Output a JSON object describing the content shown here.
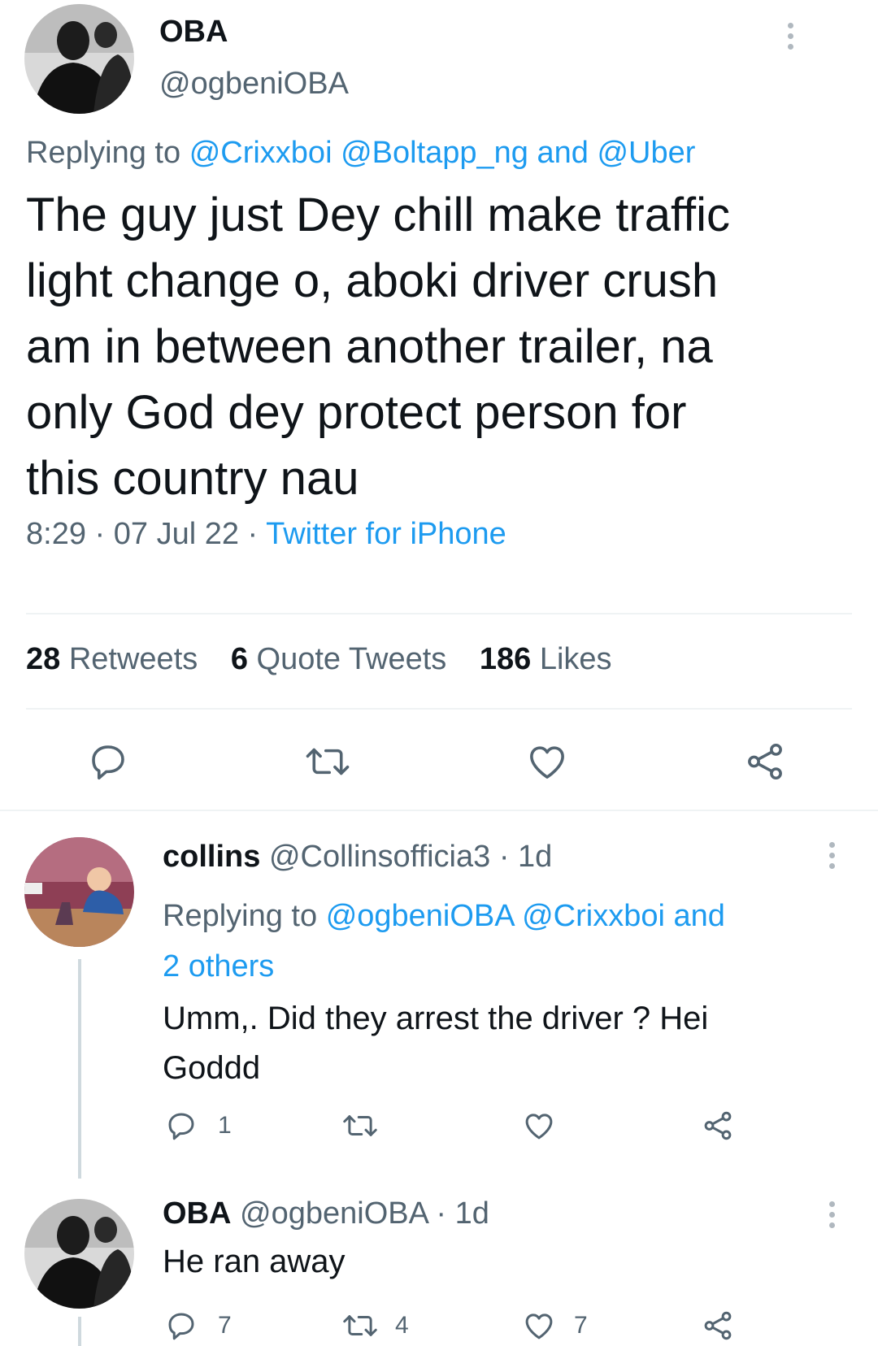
{
  "main_tweet": {
    "author_name": "OBA",
    "author_handle": "@ogbeniOBA",
    "replying_prefix": "Replying to",
    "reply_mentions": [
      "@Crixxboi",
      "@Boltapp_ng"
    ],
    "reply_and": "and",
    "reply_last": "@Uber",
    "text_lines": [
      "The guy just Dey chill make traffic",
      "light change o, aboki driver crush",
      "am in between another trailer, na",
      "only God dey protect person for",
      "this country nau"
    ],
    "time": "8:29",
    "sep": "·",
    "date": "07 Jul 22",
    "source": "Twitter for iPhone",
    "stats": {
      "retweets_count": "28",
      "retweets_label": "Retweets",
      "quotes_count": "6",
      "quotes_label": "Quote Tweets",
      "likes_count": "186",
      "likes_label": "Likes"
    }
  },
  "reply_1": {
    "author_name": "collins",
    "author_handle": "@Collinsofficia3",
    "sep": "·",
    "age": "1d",
    "replying_prefix": "Replying to",
    "mention_1": "@ogbeniOBA",
    "mention_2": "@Crixxboi",
    "and": "and",
    "others": "2 others",
    "text_lines": [
      "Umm,. Did they arrest the driver ? Hei",
      "Goddd"
    ],
    "reply_count": "1",
    "retweet_count": "",
    "like_count": ""
  },
  "reply_2": {
    "author_name": "OBA",
    "author_handle": "@ogbeniOBA",
    "sep": "·",
    "age": "1d",
    "text": "He ran away",
    "reply_count": "7",
    "retweet_count": "4",
    "like_count": "7"
  },
  "icons": [
    "reply-icon",
    "retweet-icon",
    "like-icon",
    "share-icon",
    "more-icon"
  ],
  "colors": {
    "link": "#1d9bf0",
    "muted": "#536471",
    "text": "#0f1419",
    "divider": "#eff3f4"
  }
}
